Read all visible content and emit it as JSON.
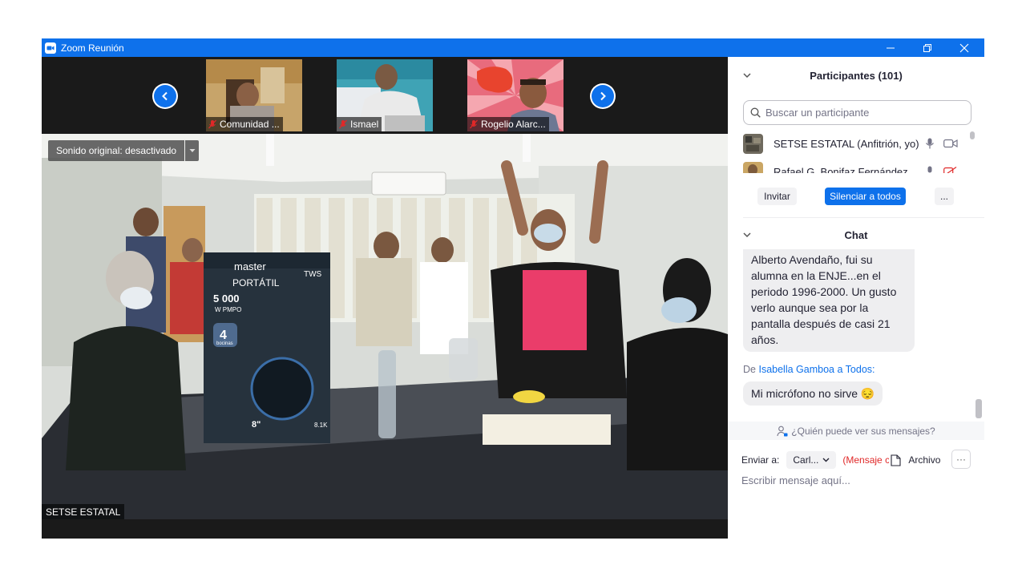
{
  "window": {
    "title": "Zoom Reunión",
    "accent": "#0e71eb"
  },
  "thumbnails": [
    {
      "name": "Comunidad ...",
      "muted": true
    },
    {
      "name": "Ismael",
      "muted": true
    },
    {
      "name": "Rogelio Alarc...",
      "muted": true
    }
  ],
  "main_video": {
    "sound_button": "Sonido original: desactivado",
    "speaker_name": "SETSE ESTATAL",
    "box_text": {
      "brand": "master",
      "product": "PORTÁTIL",
      "power": "5 000",
      "power_unit": "W PMPO",
      "speakers": "4",
      "speakers_label": "bocinas",
      "tws": "TWS",
      "size": "8\"",
      "model": "8.1K"
    }
  },
  "participants": {
    "header": "Participantes (101)",
    "search_placeholder": "Buscar un participante",
    "list": [
      {
        "name": "SETSE ESTATAL (Anfitrión, yo)",
        "mic": "on",
        "video": "off"
      },
      {
        "name": "Rafael G. Bonifaz Fernández",
        "mic": "on",
        "video": "off-muted"
      }
    ],
    "invite_label": "Invitar",
    "mute_all_label": "Silenciar a todos",
    "more_label": "..."
  },
  "chat": {
    "header": "Chat",
    "messages": [
      {
        "lines": [
          "Alberto Avendaño, fui su",
          "alumna en la ENJE...en el",
          "periodo 1996-2000. Un gusto",
          "verlo aunque sea por la",
          "pantalla después de casi 21",
          "años."
        ]
      },
      {
        "from_prefix": "De",
        "sender": "Isabella Gamboa",
        "to_text": "a Todos:",
        "lines": [
          "Mi micrófono no sirve 😔"
        ]
      }
    ],
    "who_sees": "¿Quién puede ver sus mensajes?",
    "send_to_label": "Enviar a:",
    "recipient": "Carl...",
    "private_note": "(Mensaje c",
    "file_label": "Archivo",
    "more_label": "···",
    "input_placeholder": "Escribir mensaje aquí..."
  }
}
